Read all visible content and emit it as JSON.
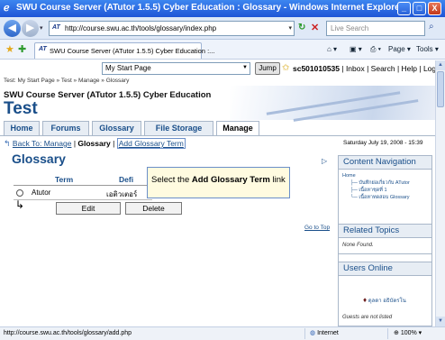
{
  "window": {
    "title": "SWU Course Server (ATutor 1.5.5) Cyber Education : Glossary - Windows Internet Explorer",
    "controls": {
      "minimize": "_",
      "maximize": "□",
      "close": "X"
    }
  },
  "browser": {
    "url": "http://course.swu.ac.th/tools/glossary/index.php",
    "search_placeholder": "Live Search",
    "tab_label": "SWU Course Server (ATutor 1.5.5) Cyber Education :...",
    "favicon": "AT",
    "commands": {
      "home": "⌂ ▾",
      "feeds": "▣ ▾",
      "print": "⎙ ▾",
      "page": "Page ▾",
      "tools": "Tools ▾"
    }
  },
  "header": {
    "jump_select_value": "My Start Page",
    "jump_button": "Jump",
    "user_links": {
      "user": "sc501010535",
      "rest": " | Inbox | Search | Help | Log-out"
    },
    "breadcrumb": "Test: My Start Page » Test » Manage » Glossary",
    "site_title": "SWU Course Server (ATutor 1.5.5) Cyber Education",
    "course_title": "Test"
  },
  "nav_tabs": {
    "home": "Home",
    "forums": "Forums",
    "glossary": "Glossary",
    "file_storage": "File Storage",
    "manage": "Manage"
  },
  "sub_nav": {
    "back": "Back To: Manage",
    "sep1": " | ",
    "current": "Glossary",
    "sep2": " | ",
    "add": "Add Glossary Term"
  },
  "date": "Saturday July 19, 2008 - 15:39",
  "page_heading": "Glossary",
  "glossary_table": {
    "headers": [
      "Term",
      "Defi"
    ],
    "rows": [
      {
        "term": "Atutor",
        "definition": "เอติวเตอร์"
      }
    ],
    "buttons": {
      "edit": "Edit",
      "delete": "Delete"
    }
  },
  "callout": {
    "prefix": "Select the ",
    "bold": "Add Glossary Term",
    "suffix": " link"
  },
  "goto_top": "Go to Top",
  "sidebar": {
    "content_navigation": {
      "title": "Content Navigation",
      "items": [
        "Home",
        "บันทึกย่อเกี่ยวกับ ATutor",
        "เนื้อหาชุดที่ 1",
        "เนื้อหาทดสอบ Glossary"
      ]
    },
    "related_topics": {
      "title": "Related Topics",
      "body": "None Found."
    },
    "users_online": {
      "title": "Users Online",
      "user": "ดุลดา อธิบัตรโน",
      "footer": "Guests are not listed"
    }
  },
  "status": {
    "url": "http://course.swu.ac.th/tools/glossary/add.php",
    "zone": "Internet",
    "zoom": "100%"
  },
  "colors": {
    "link": "#1a4f8a",
    "titlebar": "#2a62d9",
    "callout_bg": "#fffbe0"
  }
}
